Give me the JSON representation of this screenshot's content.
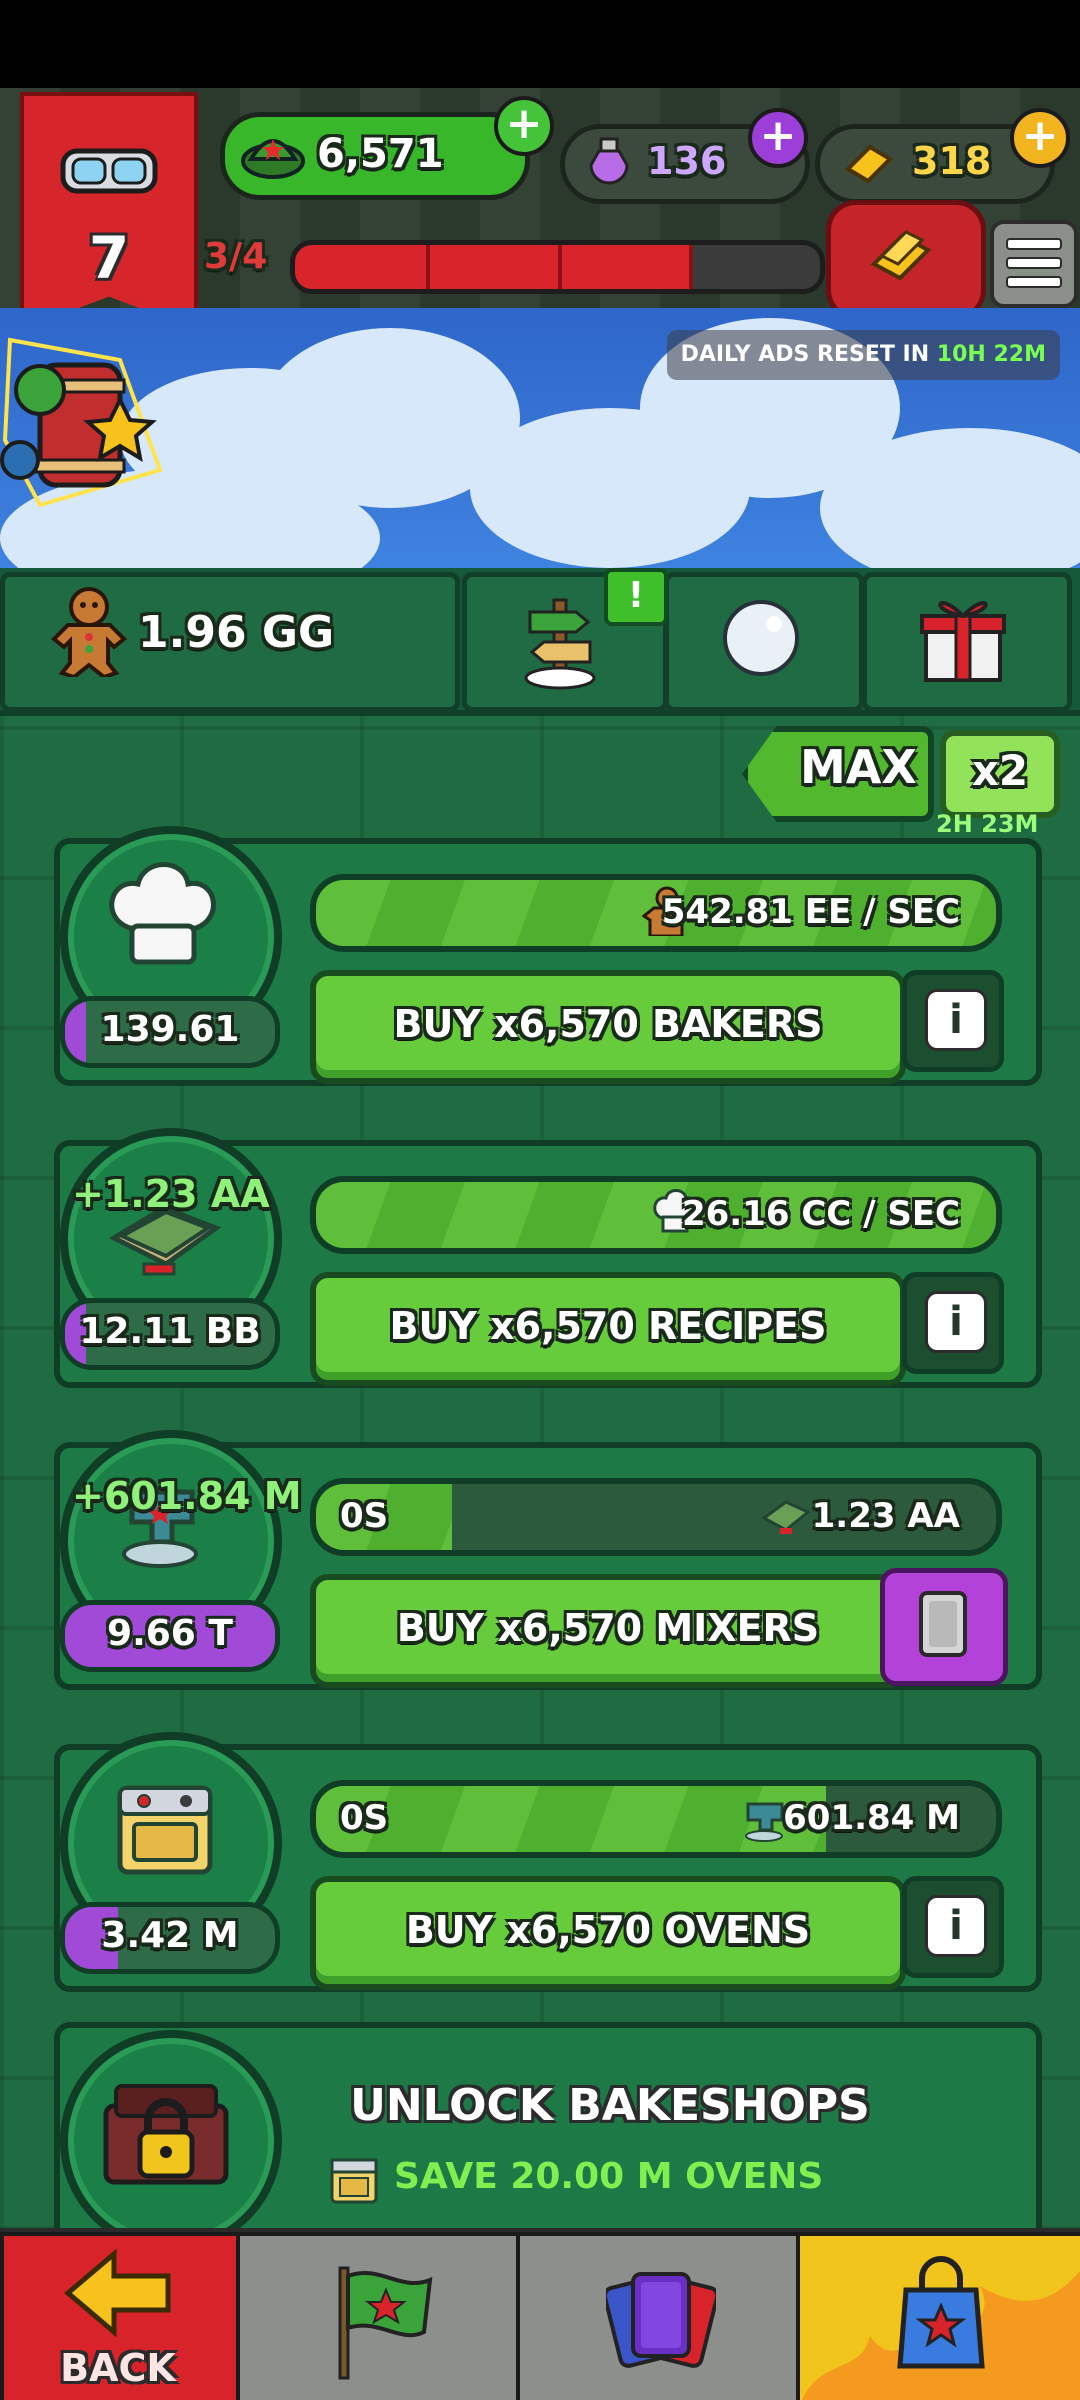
{
  "header": {
    "level": "7",
    "helmets": "6,571",
    "potions": "136",
    "gold_bars": "318",
    "progress_label": "3/4",
    "progress_fraction": 0.75,
    "daily_ads_label": "DAILY ADS RESET IN",
    "daily_ads_time": "10H 22M"
  },
  "toolbar": {
    "cookies": "1.96 GG",
    "alert_badge": "!",
    "max_label": "MAX",
    "multiplier_label": "x2",
    "multiplier_time": "2H 23M"
  },
  "rows": [
    {
      "price": "139.61 DD",
      "rate_text": "542.81 EE / SEC",
      "buy_label": "BUY x6,570 BAKERS",
      "progress": 1.0,
      "price_fill": 0.1
    },
    {
      "gain": "+1.23 AA",
      "price": "12.11 BB",
      "rate_text": "26.16 CC / SEC",
      "buy_label": "BUY x6,570 RECIPES",
      "progress": 1.0,
      "price_fill": 0.1
    },
    {
      "gain": "+601.84 M",
      "price": "9.66 T",
      "timer": "0S",
      "rate_text": "1.23 AA",
      "buy_label": "BUY x6,570 MIXERS",
      "progress": 0.2,
      "price_fill": 1.0
    },
    {
      "price": "3.42 M",
      "timer": "0S",
      "rate_text": "601.84 M",
      "buy_label": "BUY x6,570 OVENS",
      "progress": 0.75,
      "price_fill": 0.25
    }
  ],
  "unlock": {
    "title": "UNLOCK BAKESHOPS",
    "subtitle": "SAVE 20.00 M OVENS"
  },
  "nav": {
    "back_label": "BACK"
  },
  "colors": {
    "accent_green": "#67cc3c",
    "accent_red": "#d8232a",
    "accent_purple": "#a24ad8",
    "accent_gold": "#f2c51d"
  }
}
